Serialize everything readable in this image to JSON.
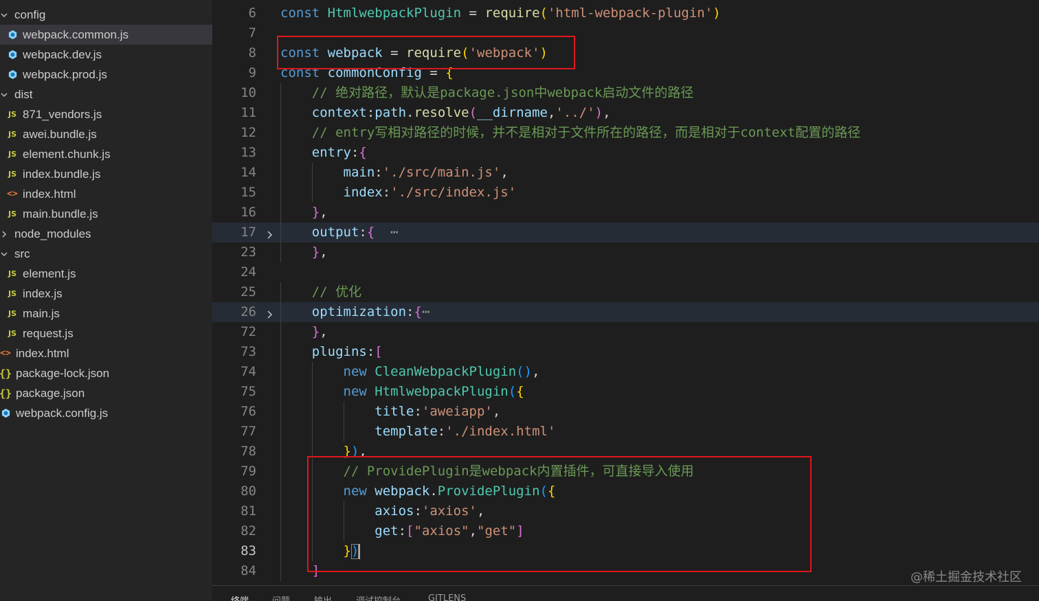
{
  "sidebar": {
    "items": [
      {
        "label": "config",
        "kind": "folder",
        "expanded": true,
        "level": 0
      },
      {
        "label": "webpack.common.js",
        "kind": "file",
        "icon": "webpack",
        "level": 1,
        "selected": true
      },
      {
        "label": "webpack.dev.js",
        "kind": "file",
        "icon": "webpack",
        "level": 1
      },
      {
        "label": "webpack.prod.js",
        "kind": "file",
        "icon": "webpack",
        "level": 1
      },
      {
        "label": "dist",
        "kind": "folder",
        "expanded": true,
        "level": 0
      },
      {
        "label": "871_vendors.js",
        "kind": "file",
        "icon": "js",
        "level": 1
      },
      {
        "label": "awei.bundle.js",
        "kind": "file",
        "icon": "js",
        "level": 1
      },
      {
        "label": "element.chunk.js",
        "kind": "file",
        "icon": "js",
        "level": 1
      },
      {
        "label": "index.bundle.js",
        "kind": "file",
        "icon": "js",
        "level": 1
      },
      {
        "label": "index.html",
        "kind": "file",
        "icon": "html",
        "level": 1
      },
      {
        "label": "main.bundle.js",
        "kind": "file",
        "icon": "js",
        "level": 1
      },
      {
        "label": "node_modules",
        "kind": "folder",
        "expanded": false,
        "level": 0
      },
      {
        "label": "src",
        "kind": "folder",
        "expanded": true,
        "level": 0
      },
      {
        "label": "element.js",
        "kind": "file",
        "icon": "js",
        "level": 1
      },
      {
        "label": "index.js",
        "kind": "file",
        "icon": "js",
        "level": 1
      },
      {
        "label": "main.js",
        "kind": "file",
        "icon": "js",
        "level": 1
      },
      {
        "label": "request.js",
        "kind": "file",
        "icon": "js",
        "level": 1
      },
      {
        "label": "index.html",
        "kind": "file",
        "icon": "html",
        "level": 0
      },
      {
        "label": "package-lock.json",
        "kind": "file",
        "icon": "json",
        "level": 0
      },
      {
        "label": "package.json",
        "kind": "file",
        "icon": "json",
        "level": 0
      },
      {
        "label": "webpack.config.js",
        "kind": "file",
        "icon": "webpack",
        "level": 0
      }
    ],
    "icon_glyphs": {
      "js": "JS",
      "html": "<>",
      "json": "{}"
    }
  },
  "editor": {
    "lines": [
      {
        "num": "6",
        "indent": 0,
        "tokens": [
          [
            "kw",
            "const "
          ],
          [
            "cls",
            "HtmlwebpackPlugin"
          ],
          [
            "op",
            " = "
          ],
          [
            "fn",
            "require"
          ],
          [
            "br1",
            "("
          ],
          [
            "str",
            "'html-webpack-plugin'"
          ],
          [
            "br1",
            ")"
          ]
        ]
      },
      {
        "num": "7",
        "indent": 0,
        "tokens": []
      },
      {
        "num": "8",
        "indent": 0,
        "tokens": [
          [
            "kw",
            "const "
          ],
          [
            "var",
            "webpack"
          ],
          [
            "op",
            " = "
          ],
          [
            "fn",
            "require"
          ],
          [
            "br1",
            "("
          ],
          [
            "str",
            "'webpack'"
          ],
          [
            "br1",
            ")"
          ]
        ]
      },
      {
        "num": "9",
        "indent": 0,
        "tokens": [
          [
            "kw",
            "const "
          ],
          [
            "var",
            "commonConfig"
          ],
          [
            "op",
            " = "
          ],
          [
            "br1",
            "{"
          ]
        ]
      },
      {
        "num": "10",
        "indent": 1,
        "tokens": [
          [
            "cm",
            "// 绝对路径，默认是package.json中webpack启动文件的路径"
          ]
        ]
      },
      {
        "num": "11",
        "indent": 1,
        "tokens": [
          [
            "var",
            "context"
          ],
          [
            "op",
            ":"
          ],
          [
            "var",
            "path"
          ],
          [
            "op",
            "."
          ],
          [
            "fn",
            "resolve"
          ],
          [
            "br2",
            "("
          ],
          [
            "var",
            "__dirname"
          ],
          [
            "op",
            ","
          ],
          [
            "str",
            "'../'"
          ],
          [
            "br2",
            ")"
          ],
          [
            "op",
            ","
          ]
        ]
      },
      {
        "num": "12",
        "indent": 1,
        "tokens": [
          [
            "cm",
            "// entry写相对路径的时候，并不是相对于文件所在的路径，而是相对于context配置的路径"
          ]
        ]
      },
      {
        "num": "13",
        "indent": 1,
        "tokens": [
          [
            "var",
            "entry"
          ],
          [
            "op",
            ":"
          ],
          [
            "br2",
            "{"
          ]
        ]
      },
      {
        "num": "14",
        "indent": 2,
        "tokens": [
          [
            "var",
            "main"
          ],
          [
            "op",
            ":"
          ],
          [
            "str",
            "'./src/main.js'"
          ],
          [
            "op",
            ","
          ]
        ]
      },
      {
        "num": "15",
        "indent": 2,
        "tokens": [
          [
            "var",
            "index"
          ],
          [
            "op",
            ":"
          ],
          [
            "str",
            "'./src/index.js'"
          ]
        ]
      },
      {
        "num": "16",
        "indent": 1,
        "tokens": [
          [
            "br2",
            "}"
          ],
          [
            "op",
            ","
          ]
        ]
      },
      {
        "num": "17",
        "indent": 1,
        "folded": true,
        "tokens": [
          [
            "var",
            "output"
          ],
          [
            "op",
            ":"
          ],
          [
            "br2",
            "{"
          ],
          [
            "ellipsis",
            "  ⋯"
          ]
        ]
      },
      {
        "num": "23",
        "indent": 1,
        "tokens": [
          [
            "br2",
            "}"
          ],
          [
            "op",
            ","
          ]
        ]
      },
      {
        "num": "24",
        "indent": 0,
        "tokens": []
      },
      {
        "num": "25",
        "indent": 1,
        "tokens": [
          [
            "cm",
            "// 优化"
          ]
        ]
      },
      {
        "num": "26",
        "indent": 1,
        "folded": true,
        "tokens": [
          [
            "var",
            "optimization"
          ],
          [
            "op",
            ":"
          ],
          [
            "br2",
            "{"
          ],
          [
            "ellipsis",
            "⋯"
          ]
        ]
      },
      {
        "num": "72",
        "indent": 1,
        "tokens": [
          [
            "br2",
            "}"
          ],
          [
            "op",
            ","
          ]
        ]
      },
      {
        "num": "73",
        "indent": 1,
        "tokens": [
          [
            "var",
            "plugins"
          ],
          [
            "op",
            ":"
          ],
          [
            "br2",
            "["
          ]
        ]
      },
      {
        "num": "74",
        "indent": 2,
        "tokens": [
          [
            "kw",
            "new "
          ],
          [
            "cls",
            "CleanWebpackPlugin"
          ],
          [
            "br3",
            "()"
          ],
          [
            "op",
            ","
          ]
        ]
      },
      {
        "num": "75",
        "indent": 2,
        "tokens": [
          [
            "kw",
            "new "
          ],
          [
            "cls",
            "HtmlwebpackPlugin"
          ],
          [
            "br3",
            "("
          ],
          [
            "br1",
            "{"
          ]
        ]
      },
      {
        "num": "76",
        "indent": 3,
        "tokens": [
          [
            "var",
            "title"
          ],
          [
            "op",
            ":"
          ],
          [
            "str",
            "'aweiapp'"
          ],
          [
            "op",
            ","
          ]
        ]
      },
      {
        "num": "77",
        "indent": 3,
        "tokens": [
          [
            "var",
            "template"
          ],
          [
            "op",
            ":"
          ],
          [
            "str",
            "'./index.html'"
          ]
        ]
      },
      {
        "num": "78",
        "indent": 2,
        "tokens": [
          [
            "br1",
            "}"
          ],
          [
            "br3",
            ")"
          ],
          [
            "op",
            ","
          ]
        ]
      },
      {
        "num": "79",
        "indent": 2,
        "tokens": [
          [
            "cm",
            "// ProvidePlugin是webpack内置插件，可直接导入使用"
          ]
        ]
      },
      {
        "num": "80",
        "indent": 2,
        "tokens": [
          [
            "kw",
            "new "
          ],
          [
            "var",
            "webpack"
          ],
          [
            "op",
            "."
          ],
          [
            "cls",
            "ProvidePlugin"
          ],
          [
            "br3",
            "("
          ],
          [
            "br1",
            "{"
          ]
        ]
      },
      {
        "num": "81",
        "indent": 3,
        "tokens": [
          [
            "var",
            "axios"
          ],
          [
            "op",
            ":"
          ],
          [
            "str",
            "'axios'"
          ],
          [
            "op",
            ","
          ]
        ]
      },
      {
        "num": "82",
        "indent": 3,
        "tokens": [
          [
            "var",
            "get"
          ],
          [
            "op",
            ":"
          ],
          [
            "br2",
            "["
          ],
          [
            "str",
            "\"axios\""
          ],
          [
            "op",
            ","
          ],
          [
            "str",
            "\"get\""
          ],
          [
            "br2",
            "]"
          ]
        ]
      },
      {
        "num": "83",
        "indent": 2,
        "current": true,
        "tokens": [
          [
            "br1",
            "}"
          ],
          [
            "br3",
            ")"
          ]
        ]
      },
      {
        "num": "84",
        "indent": 1,
        "tokens": [
          [
            "br2",
            "]"
          ]
        ]
      }
    ]
  },
  "panel": {
    "tabs": [
      "终端",
      "问题",
      "输出",
      "调试控制台",
      "GITLENS"
    ],
    "active": 0
  },
  "watermark": "@稀土掘金技术社区",
  "colors": {
    "highlight_box": "#e0161c",
    "sidebar_bg": "#252526",
    "editor_bg": "#1e1e1e"
  }
}
